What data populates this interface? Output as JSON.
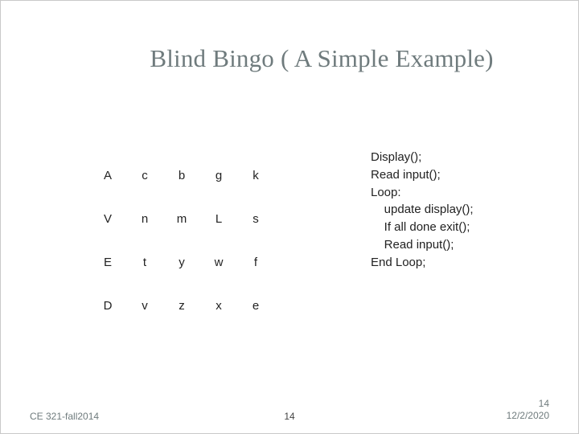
{
  "title": "Blind Bingo ( A Simple Example)",
  "grid": {
    "r0": {
      "c0": "A",
      "c1": "c",
      "c2": "b",
      "c3": "g",
      "c4": "k"
    },
    "r1": {
      "c0": "V",
      "c1": "n",
      "c2": "m",
      "c3": "L",
      "c4": "s"
    },
    "r2": {
      "c0": "E",
      "c1": "t",
      "c2": "y",
      "c3": "w",
      "c4": "f"
    },
    "r3": {
      "c0": "D",
      "c1": "v",
      "c2": "z",
      "c3": "x",
      "c4": "e"
    }
  },
  "pseudocode": "Display();\nRead input();\nLoop:\n    update display();\n    If all done exit();\n    Read input();\nEnd Loop;",
  "footer": {
    "course": "CE 321-fall2014",
    "page_center": "14",
    "page_right": "14",
    "date": "12/2/2020"
  }
}
